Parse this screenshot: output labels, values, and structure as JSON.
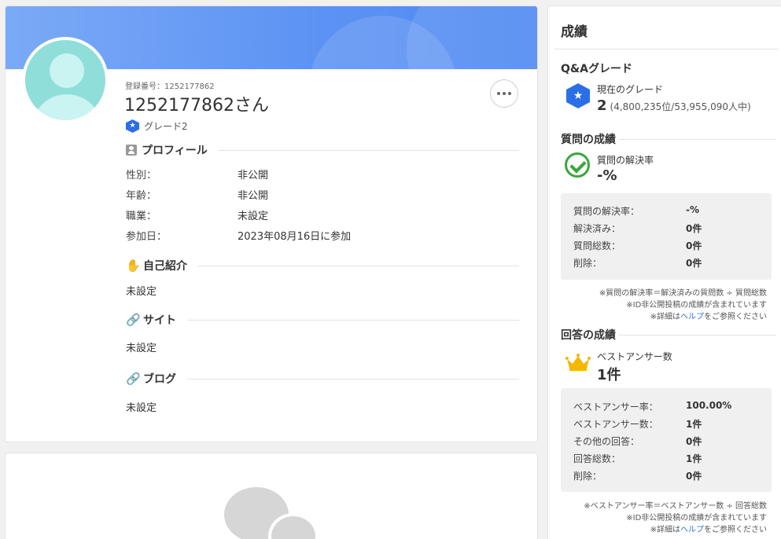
{
  "profile": {
    "reg_label": "登録番号：1252177862",
    "user_name": "1252177862さん",
    "grade_label": "グレード2",
    "sections": {
      "profile_title": "プロフィール",
      "intro_title": "自己紹介",
      "site_title": "サイト",
      "blog_title": "ブログ"
    },
    "fields": [
      {
        "label": "性別：",
        "value": "非公開"
      },
      {
        "label": "年齢：",
        "value": "非公開"
      },
      {
        "label": "職業：",
        "value": "未設定"
      },
      {
        "label": "参加日：",
        "value": "2023年08月16日に参加"
      }
    ],
    "intro_value": "未設定",
    "site_value": "未設定",
    "blog_value": "未設定"
  },
  "results": {
    "title": "成績",
    "qa_grade": {
      "heading": "Q&Aグレード",
      "current_label": "現在のグレード",
      "value": "2",
      "rank": "(4,800,235位/53,955,090人中)"
    },
    "questions": {
      "heading": "質問の成績",
      "rate_label": "質問の解決率",
      "rate_value": "-%",
      "rows": [
        {
          "k": "質問の解決率：",
          "v": "-%"
        },
        {
          "k": "解決済み：",
          "v": "0件"
        },
        {
          "k": "質問総数：",
          "v": "0件"
        },
        {
          "k": "削除：",
          "v": "0件"
        }
      ],
      "note1": "※質問の解決率＝解決済みの質問数 ÷ 質問総数",
      "note2": "※ID非公開投稿の成績が含まれています",
      "note3_pre": "※詳細は",
      "note3_link": "ヘルプ",
      "note3_post": "をご参照ください"
    },
    "answers": {
      "heading": "回答の成績",
      "best_label": "ベストアンサー数",
      "best_value": "1件",
      "rows": [
        {
          "k": "ベストアンサー率：",
          "v": "100.00%"
        },
        {
          "k": "ベストアンサー数：",
          "v": "1件"
        },
        {
          "k": "その他の回答：",
          "v": "0件"
        },
        {
          "k": "回答総数：",
          "v": "1件"
        },
        {
          "k": "削除：",
          "v": "0件"
        }
      ],
      "note1": "※ベストアンサー率＝ベストアンサー数 ÷ 回答総数",
      "note2": "※ID非公開投稿の成績が含まれています",
      "note3_pre": "※詳細は",
      "note3_link": "ヘルプ",
      "note3_post": "をご参照ください"
    }
  },
  "icons": {
    "more": "more-horizontal-icon",
    "grade": "star-hexagon-icon",
    "profile": "person-card-icon",
    "intro": "hand-icon",
    "site": "link-icon",
    "blog": "link-icon",
    "check": "check-circle-icon",
    "crown": "crown-icon"
  },
  "colors": {
    "banner": "#5c92f3",
    "grade_blue": "#2b6fe8",
    "check_green": "#3aa63c",
    "crown_gold": "#f5b800",
    "avatar_teal": "#8fded9"
  }
}
